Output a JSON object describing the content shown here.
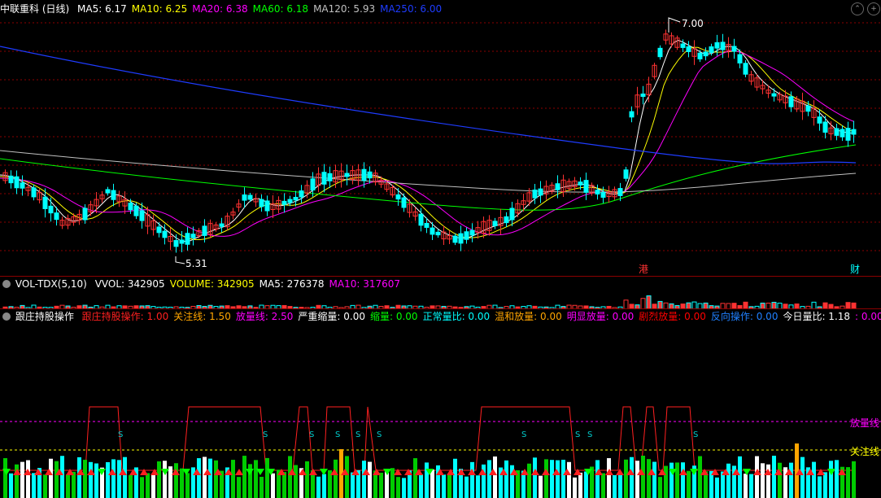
{
  "main": {
    "title": "中联重科 (日线)",
    "ma": [
      {
        "label": "MA5: 6.17",
        "color": "#ffffff"
      },
      {
        "label": "MA10: 6.25",
        "color": "#ffff00"
      },
      {
        "label": "MA20: 6.38",
        "color": "#ff00ff"
      },
      {
        "label": "MA60: 6.18",
        "color": "#00ff00"
      },
      {
        "label": "MA120: 5.93",
        "color": "#c0c0c0"
      },
      {
        "label": "MA250: 6.00",
        "color": "#1e3cff"
      }
    ],
    "high_label": "7.00",
    "low_label": "5.31",
    "tag_gang": "港",
    "tag_cai": "财"
  },
  "volume": {
    "title": "VOL-TDX(5,10)",
    "items": [
      {
        "label": "VVOL: 342905",
        "color": "#ffffff"
      },
      {
        "label": "VOLUME: 342905",
        "color": "#ffff00"
      },
      {
        "label": "MA5: 276378",
        "color": "#ffffff"
      },
      {
        "label": "MA10: 317607",
        "color": "#ff00ff"
      }
    ]
  },
  "indicator": {
    "title": "跟庄持股操作",
    "items": [
      {
        "label": "跟庄持股操作: 1.00",
        "color": "#ff2020"
      },
      {
        "label": "关注线: 1.50",
        "color": "#ffa500"
      },
      {
        "label": "放量线: 2.50",
        "color": "#ff00ff"
      },
      {
        "label": "严重缩量: 0.00",
        "color": "#ffffff"
      },
      {
        "label": "缩量: 0.00",
        "color": "#00ff00"
      },
      {
        "label": "正常量比: 0.00",
        "color": "#00ffff"
      },
      {
        "label": "温和放量: 0.00",
        "color": "#ffa500"
      },
      {
        "label": "明显放量: 0.00",
        "color": "#ff00ff"
      },
      {
        "label": "剧烈放量: 0.00",
        "color": "#ff0000"
      },
      {
        "label": "反向操作: 0.00",
        "color": "#2080ff"
      },
      {
        "label": "今日量比: 1.18",
        "color": "#ffffff"
      },
      {
        "label": ": 0.00",
        "color": "#ff00ff"
      }
    ],
    "label_fangliang": "放量线",
    "label_guanzhu": "关注线",
    "s_marker": "S"
  },
  "colors": {
    "up": "#ff3232",
    "down": "#00ffff",
    "grid": "#8b0000",
    "background": "#000000"
  }
}
